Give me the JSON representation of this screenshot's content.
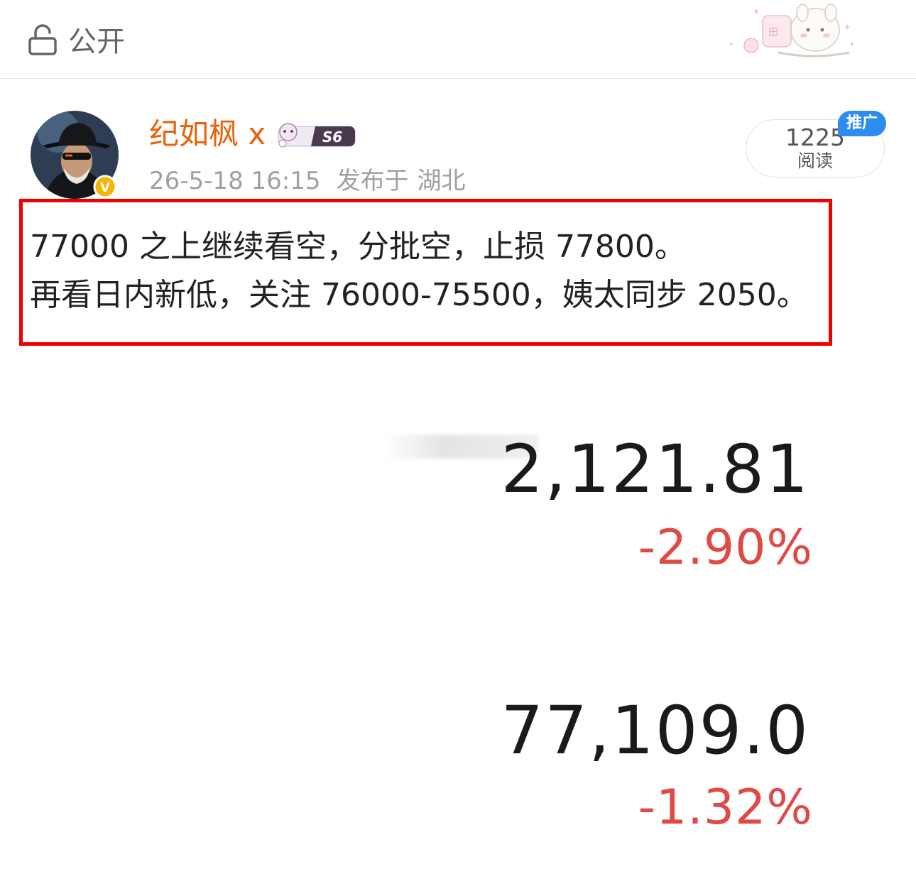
{
  "topbar": {
    "visibility_icon": "unlock-icon",
    "visibility_label": "公开",
    "sticker_icon": "cute-bunny-sticker-icon"
  },
  "post": {
    "author": {
      "name": "纪如枫 x",
      "avatar_icon": "avatar-man-hat-sunglasses",
      "verified_badge_icon": "verified-v-icon",
      "fan_badge_icon": "fan-badge-s6-icon",
      "fan_badge_text": "S6"
    },
    "time": "26-5-18 16:15",
    "location_prefix": "发布于",
    "location": "湖北",
    "reads": {
      "count": "1225",
      "label": "阅读",
      "promo_tag": "推广"
    },
    "content_lines": [
      "77000 之上继续看空，分批空，止损 77800。",
      "再看日内新低，关注 76000-75500，姨太同步 2050。"
    ]
  },
  "quotes": [
    {
      "price": "2,121.81",
      "change": "-2.90%"
    },
    {
      "price": "77,109.0",
      "change": "-1.32%"
    }
  ],
  "colors": {
    "username": "#e8620a",
    "highlight_border": "#ef0000",
    "negative_change": "#e04a44",
    "promo_tag": "#2d8cf0"
  }
}
